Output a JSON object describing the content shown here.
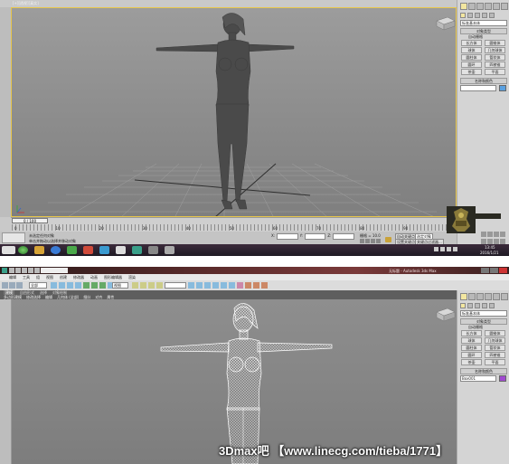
{
  "top": {
    "viewport_label": "[+][透视][真实]",
    "command_panel": {
      "object_dropdown": "标准基本体",
      "section_title": "对象类型",
      "auto_grid": "自动栅格",
      "buttons": [
        "长方体",
        "圆锥体",
        "球体",
        "几何球体",
        "圆柱体",
        "管状体",
        "圆环",
        "四棱锥",
        "茶壶",
        "平面"
      ],
      "name_rollout": "名称和颜色"
    },
    "timeline": {
      "frame_display": "0 / 100",
      "ruler_numbers": [
        "0",
        "10",
        "20",
        "30",
        "40",
        "50",
        "60",
        "70",
        "80",
        "90",
        "100"
      ]
    },
    "status": {
      "line1": "未选定任何对象",
      "line2": "单击并拖动以选择并移动对象",
      "x_label": "X:",
      "y_label": "Y:",
      "z_label": "Z:",
      "grid_text": "栅格 = 10.0",
      "auto_key": "自动关键点",
      "set_key": "设置关键点",
      "selection": "选定对象",
      "key_filters": "关键点过滤器..."
    },
    "taskbar": {
      "time": "13:45",
      "date": "2016/1/21"
    }
  },
  "bottom": {
    "window_title": "无标题 - Autodesk 3ds Max",
    "menus": [
      "编辑",
      "工具",
      "组",
      "视图",
      "创建",
      "修改器",
      "动画",
      "图形编辑器",
      "渲染"
    ],
    "toolbar_dropdown": "全部",
    "view_dropdown": "视图",
    "tabs": [
      "建模",
      "自由形式",
      "选择",
      "对象绘制"
    ],
    "subtabs": [
      "多边形建模",
      "修改选择",
      "编辑",
      "几何体 (全部)",
      "细分",
      "对齐",
      "属性"
    ],
    "command_panel": {
      "object_dropdown": "标准基本体",
      "section_title": "对象类型",
      "auto_grid": "自动栅格",
      "buttons": [
        "长方体",
        "圆锥体",
        "球体",
        "几何球体",
        "圆柱体",
        "管状体",
        "圆环",
        "四棱锥",
        "茶壶",
        "平面"
      ],
      "name_rollout": "名称和颜色",
      "name_value": "Box001"
    },
    "watermark": "3Dmax吧 【www.linecg.com/tieba/1771】"
  }
}
